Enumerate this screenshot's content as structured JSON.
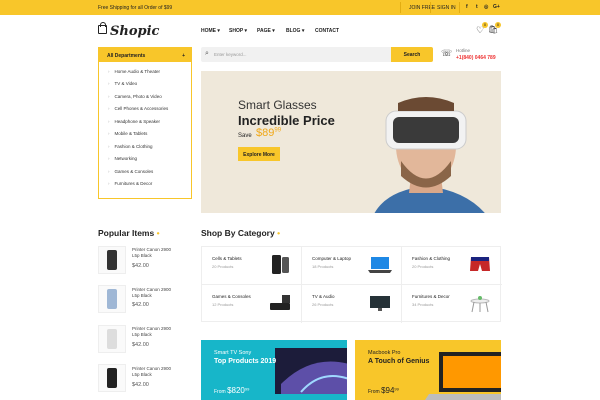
{
  "topbar": {
    "shipping": "Free Shipping for all Order of $99",
    "join": "JOIN FREE",
    "signin": "SIGN IN",
    "social": [
      "f",
      "t",
      "◎",
      "G+"
    ]
  },
  "brand": {
    "logo": "Shopic"
  },
  "nav": {
    "items": [
      "HOME ▾",
      "SHOP ▾",
      "PAGE ▾",
      "BLOG ▾",
      "CONTACT"
    ]
  },
  "header": {
    "wishlist_count": "0",
    "cart_count": "0"
  },
  "departments": {
    "title": "All Departments",
    "items": [
      "Home Audio & Theater",
      "TV & Video",
      "Camera, Photo & Video",
      "Cell Phones & Accessories",
      "Headphone & Speaker",
      "Mobile & Tablets",
      "Fashion & Clothing",
      "Networking",
      "Games & Consoles",
      "Furnitures & Decor"
    ]
  },
  "search": {
    "placeholder": "Enter keyword...",
    "button": "Search"
  },
  "contact": {
    "label": "Hotline",
    "number": "+1(840) 0464 789"
  },
  "hero": {
    "line1": "Smart Glasses",
    "line2": "Incredible Price",
    "save": "Save",
    "price": "$89",
    "cents": "99",
    "button": "Explore More"
  },
  "popular": {
    "title": "Popular Items",
    "items": [
      {
        "name": "Printer Canon 2900 L5p Black",
        "price": "$42.00"
      },
      {
        "name": "Printer Canon 2900 L5p Black",
        "price": "$42.00"
      },
      {
        "name": "Printer Canon 2900 L5p Black",
        "price": "$42.00"
      },
      {
        "name": "Printer Canon 2900 L5p Black",
        "price": "$42.00"
      }
    ]
  },
  "categories": {
    "title": "Shop By Category",
    "items": [
      {
        "name": "Cells & Tablets",
        "count": "20 Products"
      },
      {
        "name": "Computer & Laptop",
        "count": "18 Products"
      },
      {
        "name": "Fashion & Clothing",
        "count": "20 Products"
      },
      {
        "name": "Games & Consoles",
        "count": "12 Products"
      },
      {
        "name": "TV & Audio",
        "count": "26 Products"
      },
      {
        "name": "Furnitures & Decor",
        "count": "34 Products"
      }
    ]
  },
  "promo": [
    {
      "line1": "Smart TV Sony",
      "line2": "Top Products 2019",
      "from": "From",
      "price": "$820",
      "cents": "99"
    },
    {
      "line1": "Macbook Pro",
      "line2": "A Touch of Genius",
      "from": "From",
      "price": "$94",
      "cents": "99"
    }
  ],
  "colors": {
    "accent": "#f8c62a",
    "cyan": "#17b6c9",
    "price_red": "#e33333"
  }
}
